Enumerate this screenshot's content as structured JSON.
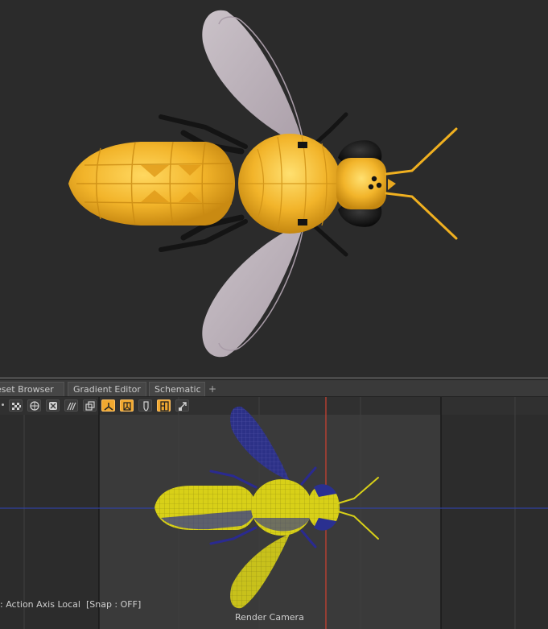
{
  "tabs": {
    "preset_browser": "eset Browser",
    "gradient_editor": "Gradient Editor",
    "schematic": "Schematic",
    "add": "+"
  },
  "toolbar": {
    "tools": [
      {
        "name": "checker-icon",
        "active": false
      },
      {
        "name": "sphere-grid-icon",
        "active": false
      },
      {
        "name": "box-x-icon",
        "active": false
      },
      {
        "name": "waves-icon",
        "active": false
      },
      {
        "name": "duplicate-icon",
        "active": false
      },
      {
        "name": "axis-local-icon",
        "active": true
      },
      {
        "name": "axis-world-icon",
        "active": true
      },
      {
        "name": "shield-icon",
        "active": false
      },
      {
        "name": "snap-icon",
        "active": true
      },
      {
        "name": "pointer-icon",
        "active": false
      }
    ]
  },
  "status": {
    "left_text": ": Action Axis Local  [Snap : OFF]",
    "camera_label": "Render Camera"
  },
  "colors": {
    "body_yellow": "#f2b42a",
    "wing": "#c9bcc6",
    "leg": "#141414",
    "wire_yellow": "#d8d018",
    "wire_blue": "#2a2a90",
    "camera_line": "#d04030",
    "axis_line": "#3040a0",
    "active_tool": "#f0a830"
  }
}
